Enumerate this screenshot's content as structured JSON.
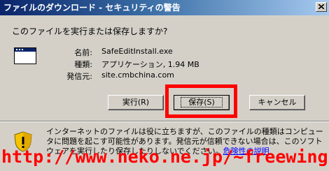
{
  "window": {
    "title": "ファイルのダウンロード - セキュリティの警告",
    "close_icon": "close-icon"
  },
  "question": "このファイルを実行または保存しますか?",
  "file_info": {
    "icon": "application-window-icon",
    "name_label": "名前:",
    "name_value": "SafeEditInstall.exe",
    "type_label": "種類:",
    "type_value": "アプリケーション, 1.94 MB",
    "from_label": "発信元:",
    "from_value": "site.cmbchina.com"
  },
  "buttons": {
    "run": "実行(R)",
    "save": "保存(S)",
    "cancel": "キャンセル"
  },
  "highlight_color": "#ff0000",
  "warning": {
    "icon": "security-shield-icon",
    "text": "インターネットのファイルは役に立ちますが、このファイルの種類はコンピュータに問題を起こす可能性があります。発信元が信頼できない場合は、このソフトウェアを実行したり保存したりしないでください。",
    "link": "危険性の説明"
  },
  "watermark": "http://www.neko.ne.jp/~freewing/"
}
